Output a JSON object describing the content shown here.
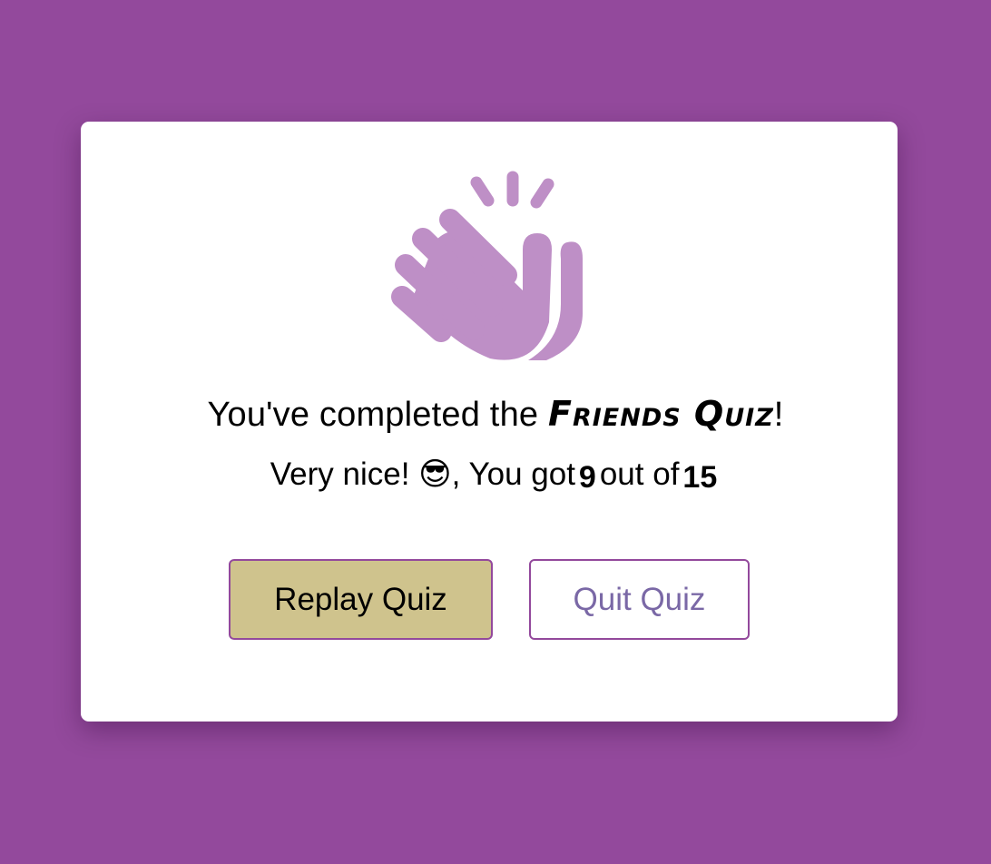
{
  "modal": {
    "icon": "waving-hand-icon",
    "title_prefix": "You've completed the ",
    "brand": "Friends Quiz",
    "title_suffix": "!",
    "score_message": "Very nice! ",
    "score_emoji": "😎",
    "score_text_1": ", You got",
    "score_value": "9",
    "score_text_2": "out of",
    "score_total": "15"
  },
  "buttons": {
    "replay_label": "Replay Quiz",
    "quit_label": "Quit Quiz"
  },
  "colors": {
    "background": "#93499c",
    "icon": "#be8fc6",
    "replay_button": "#cfc38d",
    "quit_text": "#7a68a6",
    "button_border": "#93499c"
  }
}
